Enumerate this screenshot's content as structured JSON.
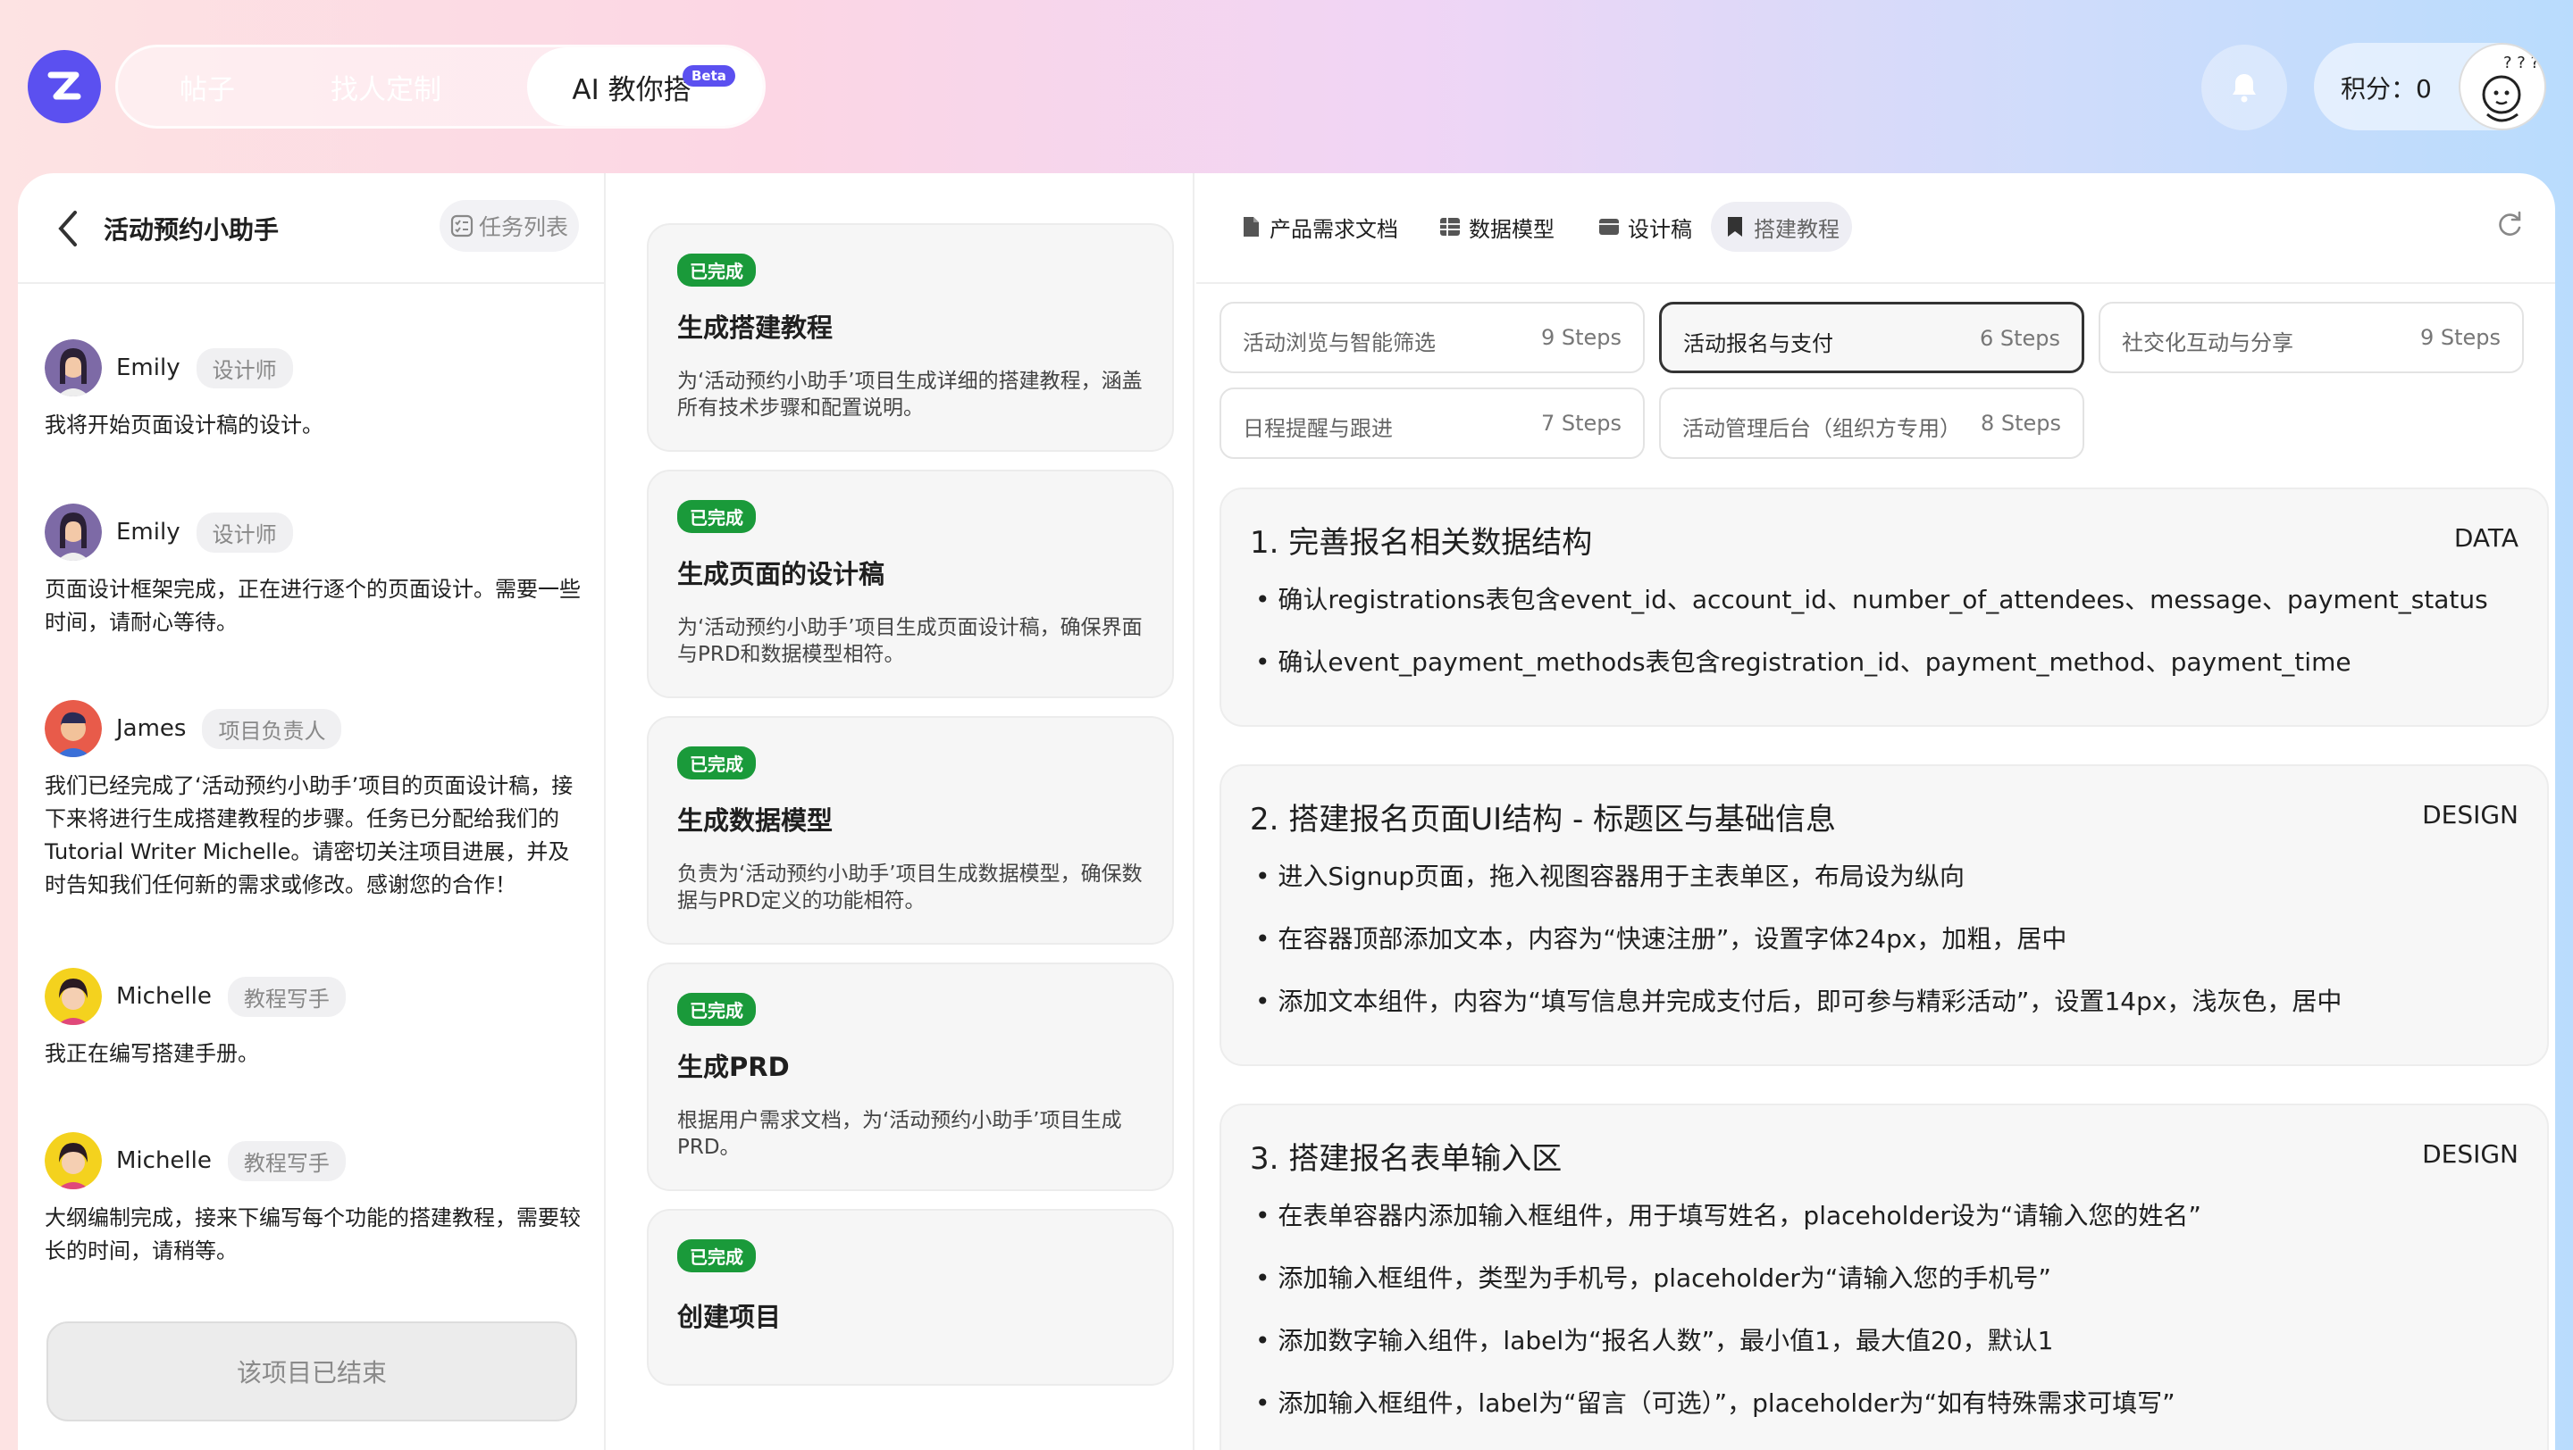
{
  "header": {
    "tabs": [
      {
        "label": "帖子"
      },
      {
        "label": "找人定制"
      },
      {
        "label": "AI 教你搭"
      }
    ],
    "beta": "Beta",
    "points": "积分：0"
  },
  "left": {
    "title": "活动预约小助手",
    "task_list": "任务列表",
    "messages": [
      {
        "name": "Emily",
        "role": "设计师",
        "text": "我将开始页面设计稿的设计。"
      },
      {
        "name": "Emily",
        "role": "设计师",
        "text": "页面设计框架完成，正在进行逐个的页面设计。需要一些时间，请耐心等待。"
      },
      {
        "name": "James",
        "role": "项目负责人",
        "text": "我们已经完成了‘活动预约小助手’项目的页面设计稿，接下来将进行生成搭建教程的步骤。任务已分配给我们的Tutorial Writer Michelle。请密切关注项目进展，并及时告知我们任何新的需求或修改。感谢您的合作！"
      },
      {
        "name": "Michelle",
        "role": "教程写手",
        "text": "我正在编写搭建手册。"
      },
      {
        "name": "Michelle",
        "role": "教程写手",
        "text": "大纲编制完成，接来下编写每个功能的搭建教程，需要较长的时间，请稍等。"
      }
    ],
    "end_button": "该项目已结束"
  },
  "tasks": [
    {
      "status": "已完成",
      "title": "生成搭建教程",
      "desc": "为‘活动预约小助手’项目生成详细的搭建教程，涵盖所有技术步骤和配置说明。"
    },
    {
      "status": "已完成",
      "title": "生成页面的设计稿",
      "desc": "为‘活动预约小助手’项目生成页面设计稿，确保界面与PRD和数据模型相符。"
    },
    {
      "status": "已完成",
      "title": "生成数据模型",
      "desc": "负责为‘活动预约小助手’项目生成数据模型，确保数据与PRD定义的功能相符。"
    },
    {
      "status": "已完成",
      "title": "生成PRD",
      "desc": "根据用户需求文档，为‘活动预约小助手’项目生成PRD。"
    },
    {
      "status": "已完成",
      "title": "创建项目",
      "desc": ""
    }
  ],
  "right": {
    "doc_tabs": [
      {
        "label": "产品需求文档"
      },
      {
        "label": "数据模型"
      },
      {
        "label": "设计稿"
      },
      {
        "label": "搭建教程"
      }
    ],
    "features": [
      {
        "name": "活动浏览与智能筛选",
        "steps": "9 Steps"
      },
      {
        "name": "活动报名与支付",
        "steps": "6 Steps"
      },
      {
        "name": "社交化互动与分享",
        "steps": "9 Steps"
      },
      {
        "name": "日程提醒与跟进",
        "steps": "7 Steps"
      },
      {
        "name": "活动管理后台（组织方专用）",
        "steps": "8 Steps"
      }
    ],
    "steps": [
      {
        "title": "1. 完善报名相关数据结构",
        "tag": "DATA",
        "lines": [
          "确认registrations表包含event_id、account_id、number_of_attendees、message、payment_status",
          "确认event_payment_methods表包含registration_id、payment_method、payment_time"
        ]
      },
      {
        "title": "2. 搭建报名页面UI结构 - 标题区与基础信息",
        "tag": "DESIGN",
        "lines": [
          "进入Signup页面，拖入视图容器用于主表单区，布局设为纵向",
          "在容器顶部添加文本，内容为“快速注册”，设置字体24px，加粗，居中",
          "添加文本组件，内容为“填写信息并完成支付后，即可参与精彩活动”，设置14px，浅灰色，居中"
        ]
      },
      {
        "title": "3. 搭建报名表单输入区",
        "tag": "DESIGN",
        "lines": [
          "在表单容器内添加输入框组件，用于填写姓名，placeholder设为“请输入您的姓名”",
          "添加输入框组件，类型为手机号，placeholder为“请输入您的手机号”",
          "添加数字输入组件，label为“报名人数”，最小值1，最大值20，默认1",
          "添加输入框组件，label为“留言（可选）”，placeholder为“如有特殊需求可填写”"
        ]
      }
    ]
  },
  "colors": {
    "accent": "#5b50f0",
    "done_green": "#1a9a3a"
  }
}
